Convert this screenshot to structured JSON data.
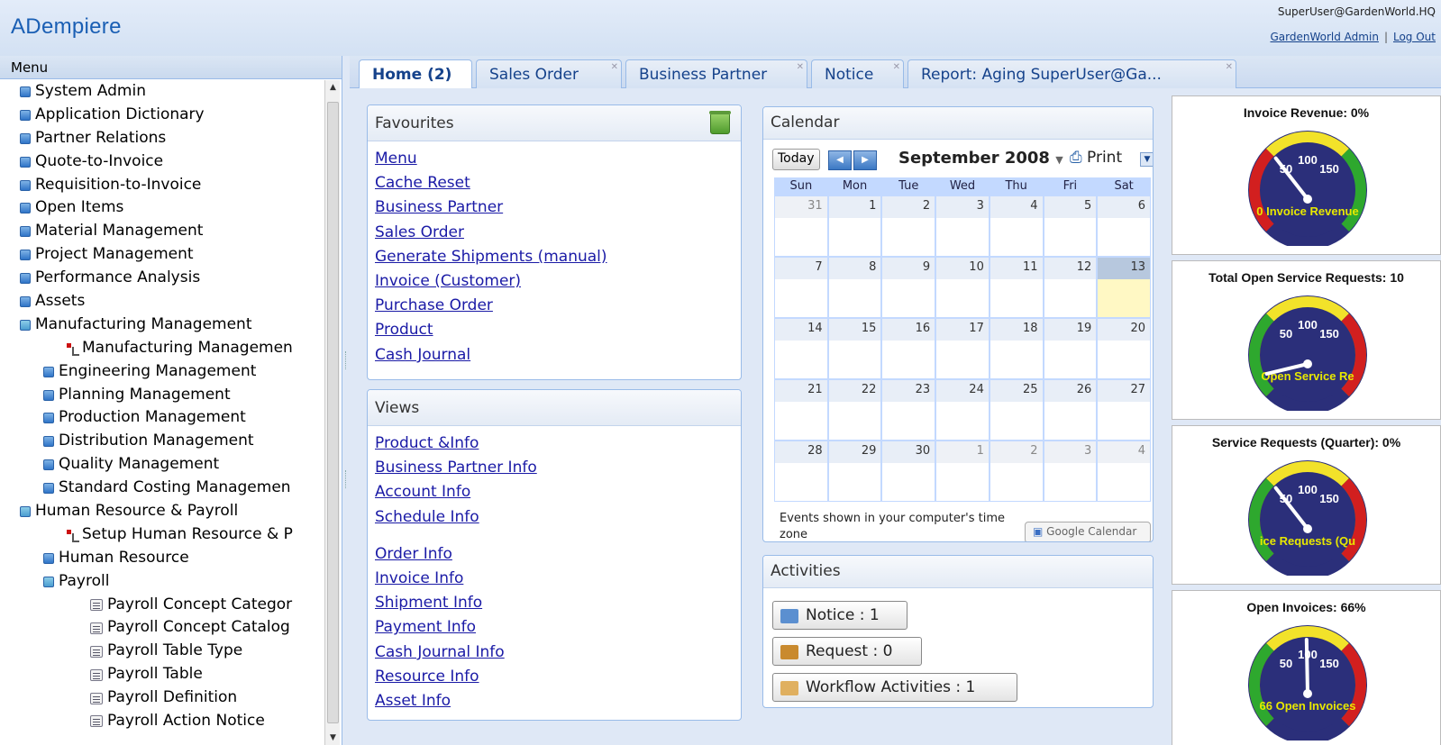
{
  "header": {
    "logo": "ADempiere",
    "user": "SuperUser@GardenWorld.HQ",
    "role_link": "GardenWorld Admin",
    "logout": "Log Out"
  },
  "menu": {
    "title": "Menu",
    "items": [
      {
        "label": "System Admin",
        "level": 0,
        "kind": "folder"
      },
      {
        "label": "Application Dictionary",
        "level": 0,
        "kind": "folder"
      },
      {
        "label": "Partner Relations",
        "level": 0,
        "kind": "folder"
      },
      {
        "label": "Quote-to-Invoice",
        "level": 0,
        "kind": "folder"
      },
      {
        "label": "Requisition-to-Invoice",
        "level": 0,
        "kind": "folder"
      },
      {
        "label": "Open Items",
        "level": 0,
        "kind": "folder"
      },
      {
        "label": "Material Management",
        "level": 0,
        "kind": "folder"
      },
      {
        "label": "Project Management",
        "level": 0,
        "kind": "folder"
      },
      {
        "label": "Performance Analysis",
        "level": 0,
        "kind": "folder"
      },
      {
        "label": "Assets",
        "level": 0,
        "kind": "folder"
      },
      {
        "label": "Manufacturing Management",
        "level": 0,
        "kind": "open"
      },
      {
        "label": "Manufacturing Managemen",
        "level": 2,
        "kind": "proc"
      },
      {
        "label": "Engineering Management",
        "level": 1,
        "kind": "folder"
      },
      {
        "label": "Planning Management",
        "level": 1,
        "kind": "folder"
      },
      {
        "label": "Production Management",
        "level": 1,
        "kind": "folder"
      },
      {
        "label": "Distribution Management",
        "level": 1,
        "kind": "folder"
      },
      {
        "label": "Quality Management",
        "level": 1,
        "kind": "folder"
      },
      {
        "label": "Standard Costing Managemen",
        "level": 1,
        "kind": "folder"
      },
      {
        "label": "Human Resource & Payroll",
        "level": 0,
        "kind": "open"
      },
      {
        "label": "Setup Human Resource & P",
        "level": 2,
        "kind": "proc"
      },
      {
        "label": "Human Resource",
        "level": 1,
        "kind": "folder"
      },
      {
        "label": "Payroll",
        "level": 1,
        "kind": "open"
      },
      {
        "label": "Payroll Concept Categor",
        "level": 3,
        "kind": "doc"
      },
      {
        "label": "Payroll Concept Catalog",
        "level": 3,
        "kind": "doc"
      },
      {
        "label": "Payroll Table Type",
        "level": 3,
        "kind": "doc"
      },
      {
        "label": "Payroll Table",
        "level": 3,
        "kind": "doc"
      },
      {
        "label": "Payroll Definition",
        "level": 3,
        "kind": "doc"
      },
      {
        "label": "Payroll Action Notice",
        "level": 3,
        "kind": "doc"
      }
    ]
  },
  "tabs": [
    {
      "label": "Home (2)",
      "active": true,
      "closable": false
    },
    {
      "label": "Sales Order",
      "active": false,
      "closable": true
    },
    {
      "label": "Business Partner",
      "active": false,
      "closable": true
    },
    {
      "label": "Notice",
      "active": false,
      "closable": true
    },
    {
      "label": "Report: Aging SuperUser@Ga...",
      "active": false,
      "closable": true
    }
  ],
  "favourites": {
    "title": "Favourites",
    "links": [
      "Menu",
      "Cache Reset",
      "Business Partner",
      "Sales Order",
      "Generate Shipments (manual)",
      "Invoice (Customer)",
      "Purchase Order",
      "Product",
      "Cash Journal"
    ]
  },
  "views": {
    "title": "Views",
    "group1": [
      "Product &Info",
      "Business Partner Info",
      "Account Info",
      "Schedule Info"
    ],
    "group2": [
      "Order Info",
      "Invoice Info",
      "Shipment Info",
      "Payment Info",
      "Cash Journal Info",
      "Resource Info",
      "Asset Info"
    ]
  },
  "calendar": {
    "title": "Calendar",
    "today_label": "Today",
    "month": "September 2008",
    "print_label": "Print",
    "days": [
      "Sun",
      "Mon",
      "Tue",
      "Wed",
      "Thu",
      "Fri",
      "Sat"
    ],
    "weeks": [
      [
        "31",
        "1",
        "2",
        "3",
        "4",
        "5",
        "6"
      ],
      [
        "7",
        "8",
        "9",
        "10",
        "11",
        "12",
        "13"
      ],
      [
        "14",
        "15",
        "16",
        "17",
        "18",
        "19",
        "20"
      ],
      [
        "21",
        "22",
        "23",
        "24",
        "25",
        "26",
        "27"
      ],
      [
        "28",
        "29",
        "30",
        "1",
        "2",
        "3",
        "4"
      ]
    ],
    "today_date": "13",
    "footer": "Events shown in your computer's time zone",
    "gcal": "Google Calendar"
  },
  "activities": {
    "title": "Activities",
    "items": [
      {
        "label": "Notice : 1",
        "icon": "notice-icon",
        "color": "#5b8fd0"
      },
      {
        "label": "Request : 0",
        "icon": "request-icon",
        "color": "#c98a2e"
      },
      {
        "label": "Workflow Activities : 1",
        "icon": "workflow-icon",
        "color": "#e0b060"
      }
    ]
  },
  "gauges": [
    {
      "title": "Invoice Revenue: 0%",
      "value": 0,
      "label": "0 Invoice Revenue"
    },
    {
      "title": "Total Open Service Requests: 10",
      "value": 10,
      "label": "Open Service Re"
    },
    {
      "title": "Service Requests (Quarter): 0%",
      "value": 0,
      "label": "ice Requests (Qu"
    },
    {
      "title": "Open Invoices: 66%",
      "value": 66,
      "label": "66 Open Invoices"
    }
  ],
  "gauge_ticks": [
    "50",
    "100",
    "150"
  ],
  "colors": {
    "accent": "#15428b",
    "link": "#1a1aa6",
    "gauge_face": "#2b2f7a",
    "gauge_red": "#d21f1f",
    "gauge_yellow": "#f2e22a",
    "gauge_green": "#2ea82e"
  }
}
